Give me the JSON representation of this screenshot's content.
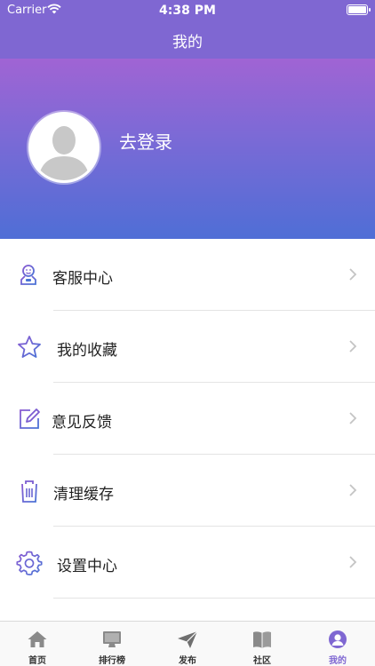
{
  "status_bar": {
    "carrier": "Carrier",
    "time": "4:38 PM"
  },
  "nav": {
    "title": "我的"
  },
  "profile": {
    "login_text": "去登录"
  },
  "menu": [
    {
      "label": "客服中心",
      "icon": "customer-service-icon"
    },
    {
      "label": "我的收藏",
      "icon": "star-icon"
    },
    {
      "label": "意见反馈",
      "icon": "feedback-edit-icon"
    },
    {
      "label": "清理缓存",
      "icon": "trash-icon"
    },
    {
      "label": "设置中心",
      "icon": "gear-icon"
    }
  ],
  "tabs": [
    {
      "label": "首页",
      "icon": "home-icon",
      "active": false
    },
    {
      "label": "排行榜",
      "icon": "monitor-icon",
      "active": false
    },
    {
      "label": "发布",
      "icon": "send-icon",
      "active": false
    },
    {
      "label": "社区",
      "icon": "book-icon",
      "active": false
    },
    {
      "label": "我的",
      "icon": "profile-icon",
      "active": true
    }
  ],
  "colors": {
    "accent": "#7f67d2",
    "icon_gradient_start": "#7b5cd0",
    "icon_gradient_end": "#4a74d6"
  }
}
